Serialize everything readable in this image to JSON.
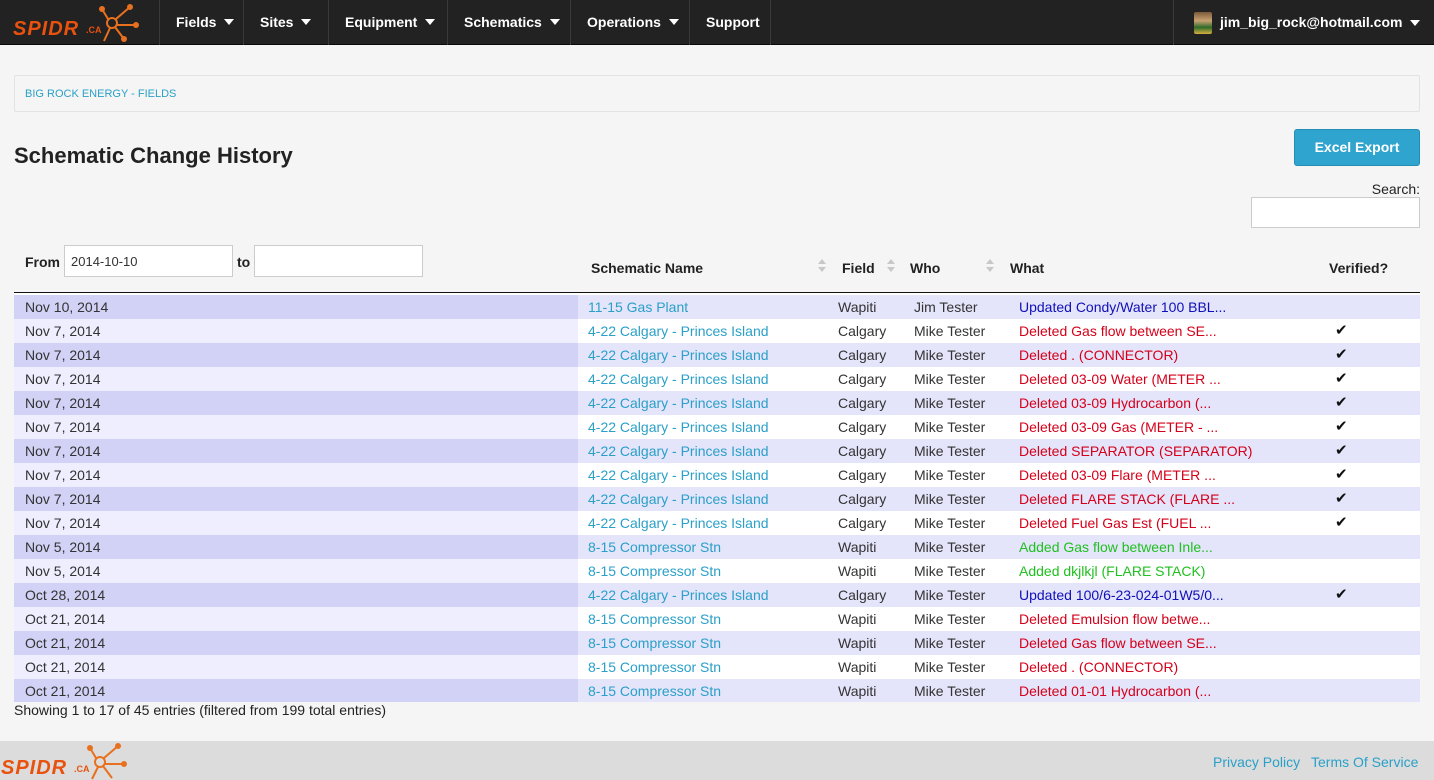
{
  "nav": {
    "logo_text": "SPIDR.CA",
    "items": [
      {
        "label": "Fields"
      },
      {
        "label": "Sites"
      },
      {
        "label": "Equipment"
      },
      {
        "label": "Schematics"
      },
      {
        "label": "Operations"
      },
      {
        "label": "Support"
      }
    ],
    "user_email": "jim_big_rock@hotmail.com"
  },
  "breadcrumb": "BIG ROCK ENERGY - FIELDS",
  "page_title": "Schematic Change History",
  "export_button": "Excel Export",
  "search": {
    "label": "Search:",
    "value": ""
  },
  "filter": {
    "from_label": "From",
    "from_value": "2014-10-10",
    "to_label": "to",
    "to_value": ""
  },
  "columns": {
    "name": "Schematic Name",
    "field": "Field",
    "who": "Who",
    "what": "What",
    "verified": "Verified?"
  },
  "colors": {
    "updated": "#1010b8",
    "deleted": "#d4001a",
    "added": "#20c020"
  },
  "rows": [
    {
      "date": "Nov 10, 2014",
      "name": "11-15 Gas Plant",
      "field": "Wapiti",
      "who": "Jim Tester",
      "what": "Updated Condy/Water 100 BBL...",
      "kind": "updated",
      "verified": ""
    },
    {
      "date": "Nov 7, 2014",
      "name": "4-22 Calgary - Princes Island",
      "field": "Calgary",
      "who": "Mike Tester",
      "what": "Deleted Gas flow between SE...",
      "kind": "deleted",
      "verified": "✔"
    },
    {
      "date": "Nov 7, 2014",
      "name": "4-22 Calgary - Princes Island",
      "field": "Calgary",
      "who": "Mike Tester",
      "what": "Deleted . (CONNECTOR)",
      "kind": "deleted",
      "verified": "✔"
    },
    {
      "date": "Nov 7, 2014",
      "name": "4-22 Calgary - Princes Island",
      "field": "Calgary",
      "who": "Mike Tester",
      "what": "Deleted 03-09 Water (METER ...",
      "kind": "deleted",
      "verified": "✔"
    },
    {
      "date": "Nov 7, 2014",
      "name": "4-22 Calgary - Princes Island",
      "field": "Calgary",
      "who": "Mike Tester",
      "what": "Deleted 03-09 Hydrocarbon (...",
      "kind": "deleted",
      "verified": "✔"
    },
    {
      "date": "Nov 7, 2014",
      "name": "4-22 Calgary - Princes Island",
      "field": "Calgary",
      "who": "Mike Tester",
      "what": "Deleted 03-09 Gas (METER - ...",
      "kind": "deleted",
      "verified": "✔"
    },
    {
      "date": "Nov 7, 2014",
      "name": "4-22 Calgary - Princes Island",
      "field": "Calgary",
      "who": "Mike Tester",
      "what": "Deleted SEPARATOR (SEPARATOR)",
      "kind": "deleted",
      "verified": "✔"
    },
    {
      "date": "Nov 7, 2014",
      "name": "4-22 Calgary - Princes Island",
      "field": "Calgary",
      "who": "Mike Tester",
      "what": "Deleted 03-09 Flare (METER ...",
      "kind": "deleted",
      "verified": "✔"
    },
    {
      "date": "Nov 7, 2014",
      "name": "4-22 Calgary - Princes Island",
      "field": "Calgary",
      "who": "Mike Tester",
      "what": "Deleted FLARE STACK (FLARE ...",
      "kind": "deleted",
      "verified": "✔"
    },
    {
      "date": "Nov 7, 2014",
      "name": "4-22 Calgary - Princes Island",
      "field": "Calgary",
      "who": "Mike Tester",
      "what": "Deleted Fuel Gas Est (FUEL ...",
      "kind": "deleted",
      "verified": "✔"
    },
    {
      "date": "Nov 5, 2014",
      "name": "8-15 Compressor Stn",
      "field": "Wapiti",
      "who": "Mike Tester",
      "what": "Added Gas flow between Inle...",
      "kind": "added",
      "verified": ""
    },
    {
      "date": "Nov 5, 2014",
      "name": "8-15 Compressor Stn",
      "field": "Wapiti",
      "who": "Mike Tester",
      "what": "Added dkjlkjl (FLARE STACK)",
      "kind": "added",
      "verified": ""
    },
    {
      "date": "Oct 28, 2014",
      "name": "4-22 Calgary - Princes Island",
      "field": "Calgary",
      "who": "Mike Tester",
      "what": "Updated 100/6-23-024-01W5/0...",
      "kind": "updated",
      "verified": "✔"
    },
    {
      "date": "Oct 21, 2014",
      "name": "8-15 Compressor Stn",
      "field": "Wapiti",
      "who": "Mike Tester",
      "what": "Deleted Emulsion flow betwe...",
      "kind": "deleted",
      "verified": ""
    },
    {
      "date": "Oct 21, 2014",
      "name": "8-15 Compressor Stn",
      "field": "Wapiti",
      "who": "Mike Tester",
      "what": "Deleted Gas flow between SE...",
      "kind": "deleted",
      "verified": ""
    },
    {
      "date": "Oct 21, 2014",
      "name": "8-15 Compressor Stn",
      "field": "Wapiti",
      "who": "Mike Tester",
      "what": "Deleted . (CONNECTOR)",
      "kind": "deleted",
      "verified": ""
    },
    {
      "date": "Oct 21, 2014",
      "name": "8-15 Compressor Stn",
      "field": "Wapiti",
      "who": "Mike Tester",
      "what": "Deleted 01-01 Hydrocarbon (...",
      "kind": "deleted",
      "verified": ""
    }
  ],
  "info_text": "Showing 1 to 17 of 45 entries (filtered from 199 total entries)",
  "footer": {
    "privacy": "Privacy Policy",
    "terms": "Terms Of Service"
  }
}
